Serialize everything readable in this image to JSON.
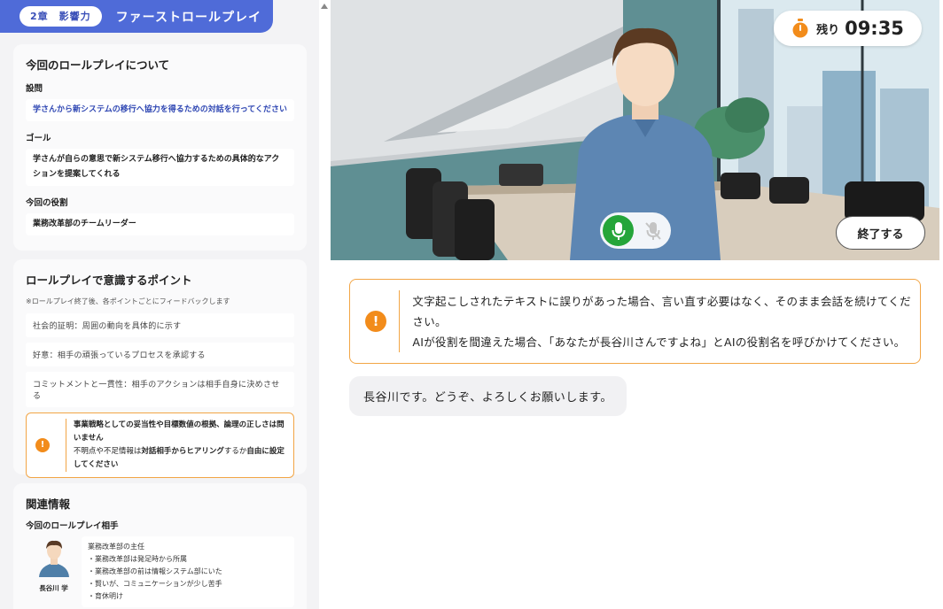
{
  "header": {
    "chapter": "2章　影響力",
    "title": "ファーストロールプレイ"
  },
  "about": {
    "heading": "今回のロールプレイについて",
    "question_label": "設問",
    "question": "学さんから新システムの移行へ協力を得るための対話を行ってください",
    "goal_label": "ゴール",
    "goal": "学さんが自らの意思で新システム移行へ協力するための具体的なアクションを提案してくれる",
    "role_label": "今回の役割",
    "role": "業務改革部のチームリーダー"
  },
  "points": {
    "heading": "ロールプレイで意識するポイント",
    "note": "※ロールプレイ終了後、各ポイントごとにフィードバックします",
    "items": [
      "社会的証明：周囲の動向を具体的に示す",
      "好意：相手の頑張っているプロセスを承認する",
      "コミットメントと一貫性：相手のアクションは相手自身に決めさせる"
    ],
    "warning_line1": "事業戦略としての妥当性や目標数値の根拠、論理の正しさは問いません",
    "warning_line2a": "不明点や不足情報は",
    "warning_line2b": "対話相手からヒアリング",
    "warning_line2c": "するか",
    "warning_line2d": "自由に設定してください"
  },
  "related": {
    "heading": "関連情報",
    "partner_label": "今回のロールプレイ相手",
    "partner_name": "長谷川 学",
    "profile_title": "業務改革部の主任",
    "profile_items": [
      "・業務改革部は発足時から所属",
      "・業務改革部の前は情報システム部にいた",
      "・賢いが、コミュニケーションが少し苦手",
      "・育休明け"
    ]
  },
  "session": {
    "remaining_label": "残り",
    "remaining_time": "09:35",
    "end_button": "終了する"
  },
  "notice": {
    "line1": "文字起こしされたテキストに誤りがあった場合、言い直す必要はなく、そのまま会話を続けてください。",
    "line2": "AIが役割を間違えた場合、「あなたが長谷川さんですよね」とAIの役割名を呼びかけてください。"
  },
  "chat": {
    "message": "長谷川です。どうぞ、よろしくお願いします。"
  },
  "colors": {
    "accent": "#4f6bd8",
    "warning": "#f28c1b",
    "mic_active": "#25a53a"
  }
}
